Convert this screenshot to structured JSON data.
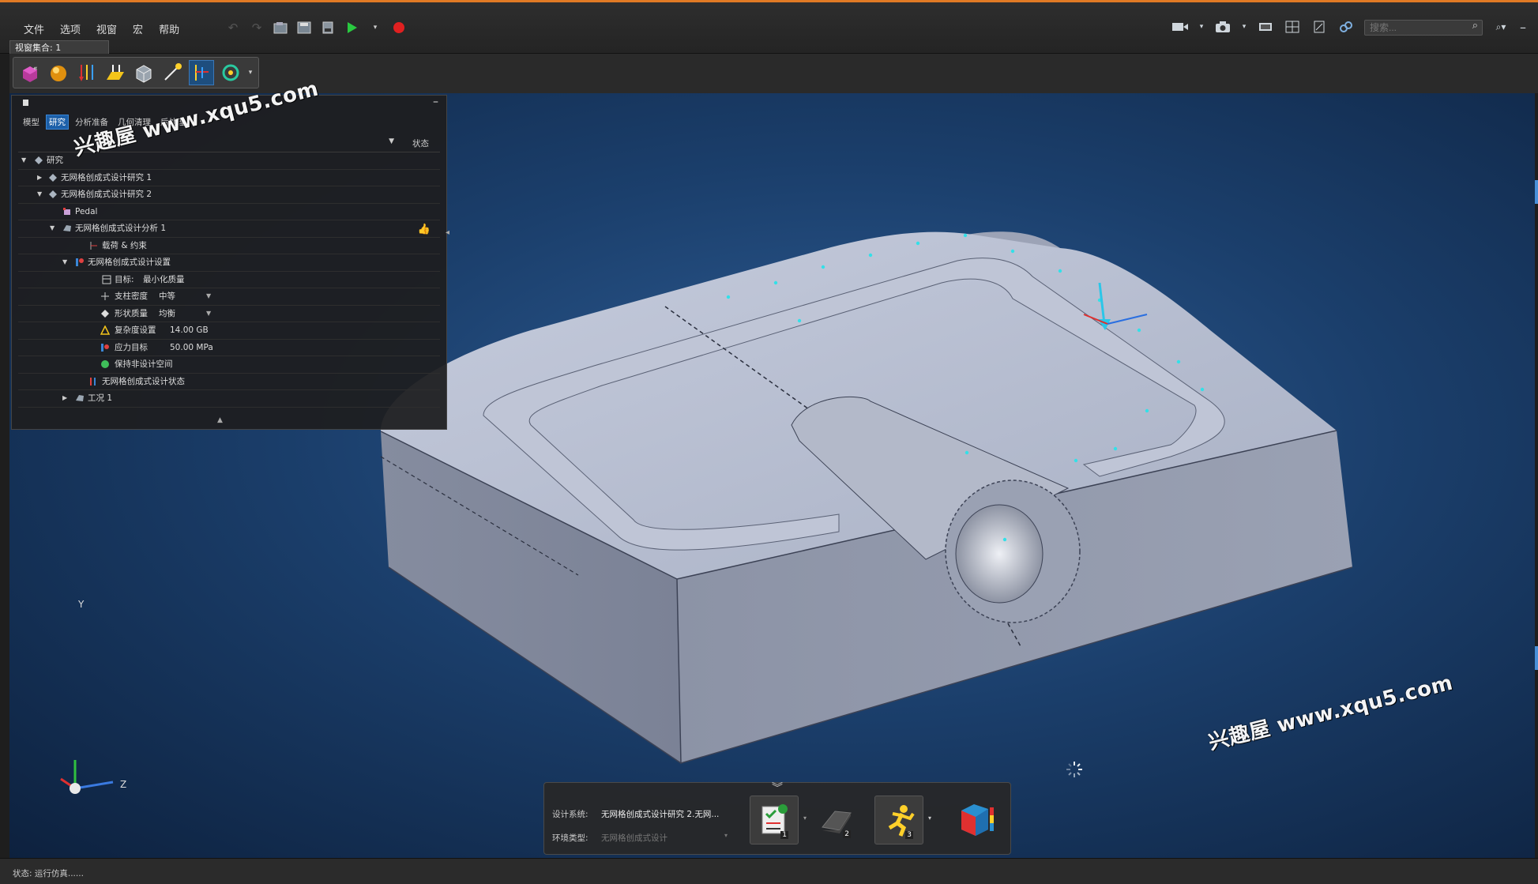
{
  "menu": [
    "文件",
    "选项",
    "视窗",
    "宏",
    "帮助"
  ],
  "search": {
    "placeholder": "搜索..."
  },
  "view_tab": "视窗集合: 1",
  "browser": {
    "tabs": [
      "模型",
      "研究",
      "分析准备",
      "几何清理",
      "后处理"
    ],
    "active_tab": "研究",
    "status_header": "状态",
    "tree": {
      "root": "研究",
      "study1": "无网格创成式设计研究 1",
      "study2": "无网格创成式设计研究 2",
      "pedal": "Pedal",
      "analysis": "无网格创成式设计分析 1",
      "loads": "载荷 & 约束",
      "settings": "无网格创成式设计设置",
      "goal_label": "目标:",
      "goal_value": "最小化质量",
      "support_label": "支柱密度",
      "support_value": "中等",
      "shape_label": "形状质量",
      "shape_value": "均衡",
      "memory_label": "复杂度设置",
      "memory_value": "14.00 GB",
      "stress_label": "应力目标",
      "stress_value": "50.00 MPa",
      "preserve": "保持非设计空间",
      "state": "无网格创成式设计状态",
      "case": "工况 1"
    }
  },
  "watermark": "兴趣屋 www.xqu5.com",
  "axes": {
    "y": "Y",
    "z": "Z"
  },
  "design_panel": {
    "system_label": "设计系统:",
    "system_value": "无网格创成式设计研究 2.无网...",
    "env_label": "环境类型:",
    "env_value": "无网格创成式设计",
    "badges": [
      "1",
      "2",
      "3"
    ]
  },
  "status": "状态: 运行仿真......"
}
